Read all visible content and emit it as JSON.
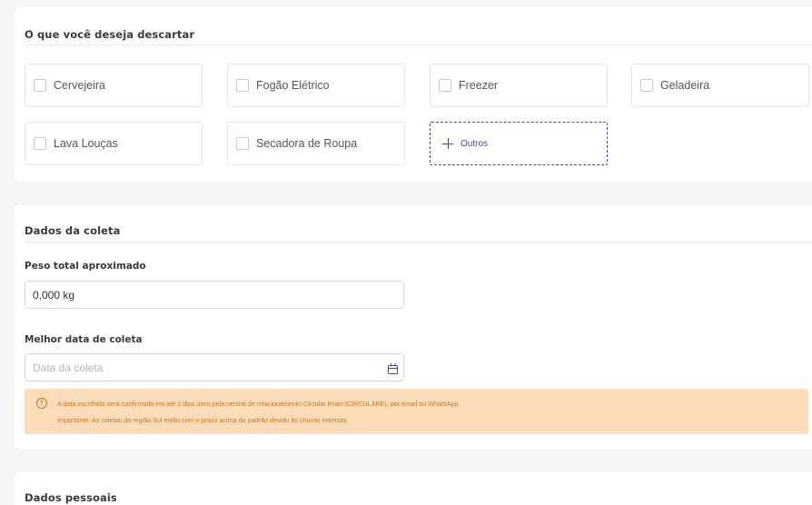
{
  "sections": {
    "discard": {
      "title": "O que você deseja descartar",
      "options": [
        "Cervejeira",
        "Fogão Elétrico",
        "Freezer",
        "Geladeira",
        "Lava Louças",
        "Secadora de Roupa"
      ],
      "others_label": "Outros"
    },
    "collection": {
      "title": "Dados da coleta",
      "weight_label": "Peso total aproximado",
      "weight_value": "0,000 kg",
      "date_label": "Melhor data de coleta",
      "date_placeholder": "Data da coleta",
      "warning_line1": "A data escolhida será confirmada em até 2 dias úteis pela central de relacionamento Circular Brain (CIRCULARE), por email ou WhatsApp.",
      "warning_line2": "Importante: As coletas da região Sul estão com o prazo acima do padrão devido às chuvas intensas."
    },
    "personal": {
      "title": "Dados pessoais"
    }
  },
  "colors": {
    "accent": "#3b4a9e",
    "warning_bg": "#fcdcb8",
    "warning_text": "#c7762a"
  }
}
